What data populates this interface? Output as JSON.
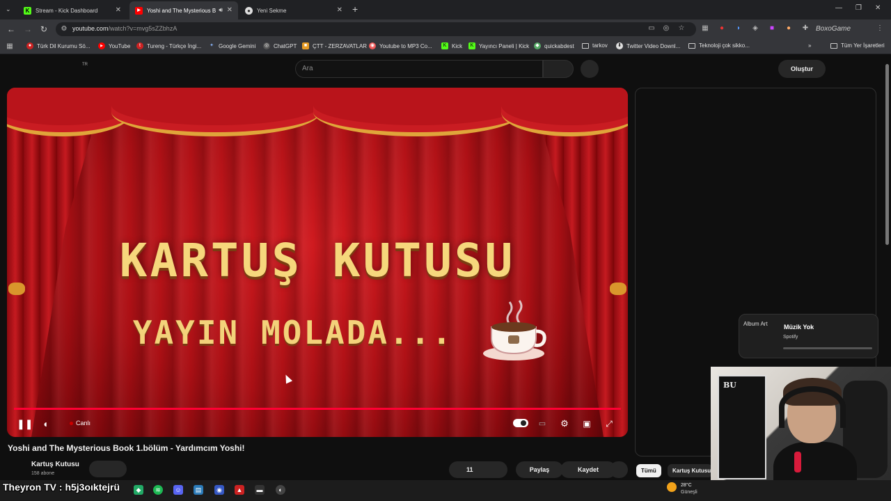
{
  "browser": {
    "tabs": [
      {
        "title": "Stream - Kick Dashboard",
        "icon": "kick-icon"
      },
      {
        "title": "Yoshi and The Mysterious B",
        "icon": "youtube-icon"
      },
      {
        "title": "Yeni Sekme",
        "icon": "chrome-icon"
      }
    ],
    "new_tab": "+",
    "url_host": "youtube.com",
    "url_path": "/watch?v=mvg5sZZbhzA",
    "bookmarks": [
      "Türk Dil Kurumu Sö...",
      "YouTube",
      "Tureng - Türkçe İngi...",
      "Google Gemini",
      "ChatGPT",
      "ÇTT - ZERZAVATLAR",
      "Youtube to MP3 Co...",
      "Kick",
      "Yayıncı Paneli | Kick",
      "quickabdest",
      "tarkov",
      "Twitter Video Downl...",
      "Teknoloji çok sikko..."
    ],
    "all_bookmarks": "Tüm Yer İşaretleri",
    "extension_overlay": "BoxoGame"
  },
  "youtube": {
    "region": "TR",
    "search_placeholder": "Ara",
    "create_label": "Oluştur",
    "player": {
      "line1": "KARTUŞ KUTUSU",
      "line2": "YAYIN MOLADA...",
      "live_label": "Canlı"
    },
    "video_title": "Yoshi and The Mysterious Book 1.bölüm - Yardımcım Yoshi!",
    "channel_name": "Kartuş Kutusu",
    "subscribers": "158 abone",
    "likes": "11",
    "share": "Paylaş",
    "save": "Kaydet",
    "chips": [
      "Tümü",
      "Kartuş Kutusu"
    ]
  },
  "overlays": {
    "album_art_alt": "Album Art",
    "music_title": "Müzik Yok",
    "music_source": "Spotify",
    "streamer_text": "Theyron TV : h5j3oıktejrü",
    "poster_text": "BU"
  },
  "taskbar": {
    "temperature": "28°C",
    "weather": "Güneşli"
  }
}
